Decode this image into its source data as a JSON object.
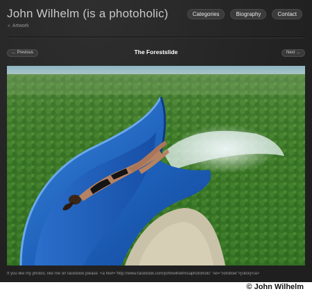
{
  "header": {
    "site_title": "John Wilhelm (is a photoholic)",
    "nav": [
      {
        "label": "Categories"
      },
      {
        "label": "Biography"
      },
      {
        "label": "Contact"
      }
    ]
  },
  "breadcrumb": {
    "arrow_icon": "«",
    "label": "Artwork"
  },
  "pager": {
    "prev_label": "← Previous",
    "next_label": "Next →",
    "photo_title": "The Forestslide"
  },
  "photo": {
    "subject": "woman in bikini on blue water slide above forest"
  },
  "footer": {
    "text": "If you like my photos, like me on facebook please: <a href=\"http://www.facebook.com/johnwilhelmisaphotoholic\" rel=\"nofollow\">[click]</a>"
  },
  "copyright": "© John Wilhelm"
}
